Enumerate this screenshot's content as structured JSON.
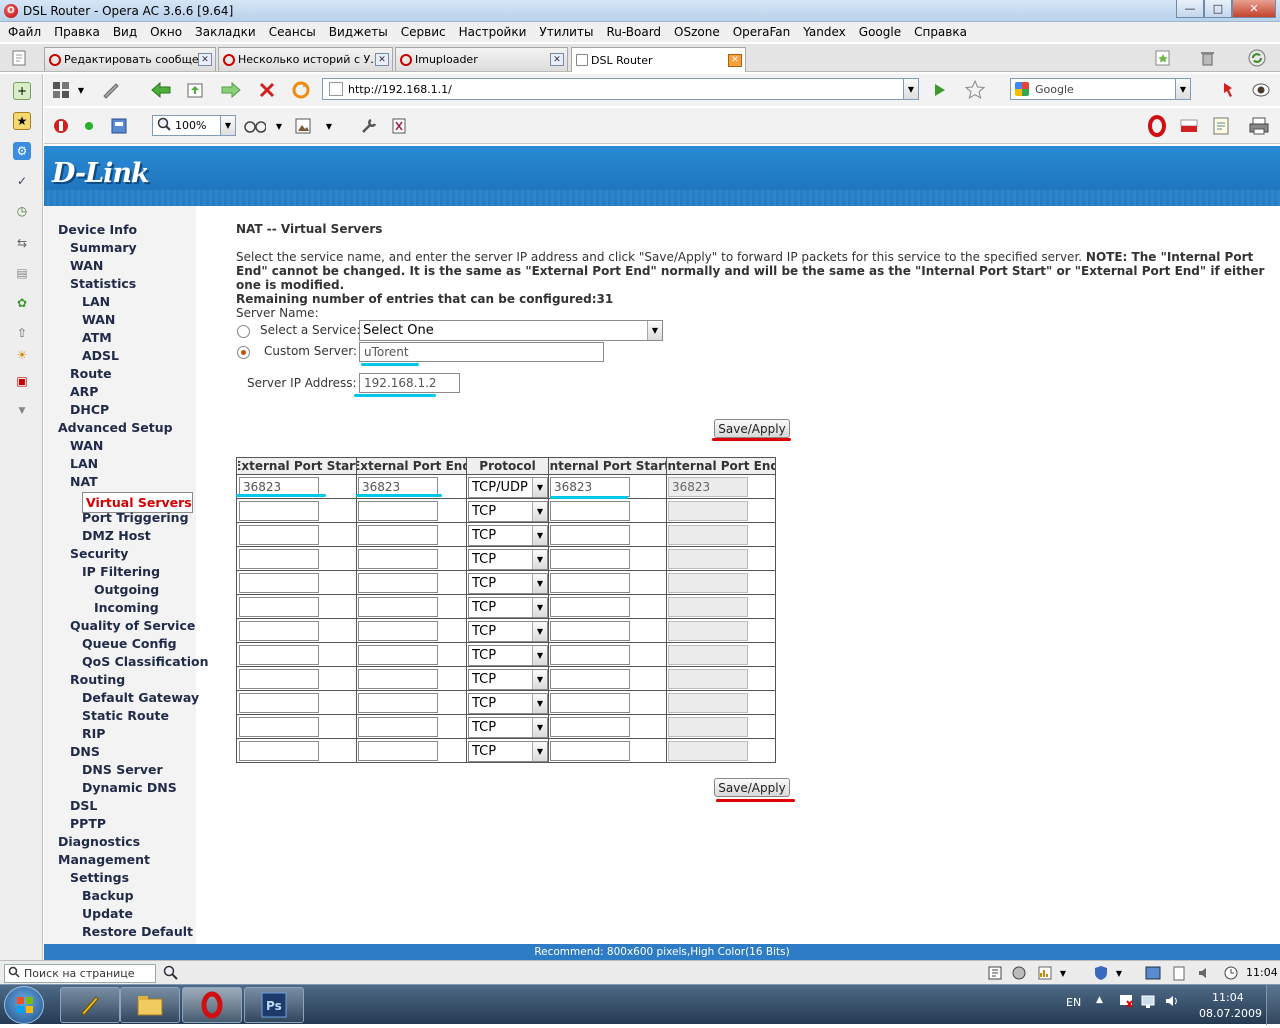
{
  "window": {
    "title": "DSL Router - Opera AC 3.6.6 [9.64]"
  },
  "menu": [
    "Файл",
    "Правка",
    "Вид",
    "Окно",
    "Закладки",
    "Сеансы",
    "Виджеты",
    "Сервис",
    "Настройки",
    "Утилиты",
    "Ru-Board",
    "OSzone",
    "OperaFan",
    "Yandex",
    "Google",
    "Справка"
  ],
  "tabs": [
    {
      "label": "Редактировать сообще..."
    },
    {
      "label": "Несколько историй с У..."
    },
    {
      "label": "Imuploader"
    },
    {
      "label": "DSL Router"
    }
  ],
  "address": {
    "url": "http://192.168.1.1/"
  },
  "search": {
    "engine": "Google"
  },
  "zoom": {
    "level": "100%"
  },
  "brand": {
    "logo": "D-Link"
  },
  "nav": {
    "items": [
      "Device Info",
      "Summary",
      "WAN",
      "Statistics",
      "LAN",
      "WAN",
      "ATM",
      "ADSL",
      "Route",
      "ARP",
      "DHCP",
      "Advanced Setup",
      "WAN",
      "LAN",
      "NAT",
      "Virtual Servers",
      "Port Triggering",
      "DMZ Host",
      "Security",
      "IP Filtering",
      "Outgoing",
      "Incoming",
      "Quality of Service",
      "Queue Config",
      "QoS Classification",
      "Routing",
      "Default Gateway",
      "Static Route",
      "RIP",
      "DNS",
      "DNS Server",
      "Dynamic DNS",
      "DSL",
      "PPTP",
      "Diagnostics",
      "Management",
      "Settings",
      "Backup",
      "Update",
      "Restore Default"
    ]
  },
  "page": {
    "title": "NAT -- Virtual Servers",
    "desc1": "Select the service name, and enter the server IP address and click \"Save/Apply\" to forward IP packets for this service to the specified server.",
    "note": "NOTE: The \"Internal Port End\" cannot be changed. It is the same as \"External Port End\" normally and will be the same as the \"Internal Port Start\" or \"External Port End\" if either one is modified.",
    "remaining": "Remaining number of entries that can be configured:31",
    "server_name_label": "Server Name:",
    "select_service_label": "Select a Service:",
    "select_service_value": "Select One",
    "custom_server_label": "Custom Server:",
    "custom_server_value": "uTorent",
    "server_ip_label": "Server IP Address:",
    "server_ip_value": "192.168.1.2",
    "save_label": "Save/Apply"
  },
  "table": {
    "headers": [
      "External Port Start",
      "External Port End",
      "Protocol",
      "Internal Port Start",
      "Internal Port End"
    ],
    "rows": [
      {
        "ext_start": "36823",
        "ext_end": "36823",
        "protocol": "TCP/UDP",
        "int_start": "36823",
        "int_end": "36823"
      },
      {
        "ext_start": "",
        "ext_end": "",
        "protocol": "TCP",
        "int_start": "",
        "int_end": ""
      },
      {
        "ext_start": "",
        "ext_end": "",
        "protocol": "TCP",
        "int_start": "",
        "int_end": ""
      },
      {
        "ext_start": "",
        "ext_end": "",
        "protocol": "TCP",
        "int_start": "",
        "int_end": ""
      },
      {
        "ext_start": "",
        "ext_end": "",
        "protocol": "TCP",
        "int_start": "",
        "int_end": ""
      },
      {
        "ext_start": "",
        "ext_end": "",
        "protocol": "TCP",
        "int_start": "",
        "int_end": ""
      },
      {
        "ext_start": "",
        "ext_end": "",
        "protocol": "TCP",
        "int_start": "",
        "int_end": ""
      },
      {
        "ext_start": "",
        "ext_end": "",
        "protocol": "TCP",
        "int_start": "",
        "int_end": ""
      },
      {
        "ext_start": "",
        "ext_end": "",
        "protocol": "TCP",
        "int_start": "",
        "int_end": ""
      },
      {
        "ext_start": "",
        "ext_end": "",
        "protocol": "TCP",
        "int_start": "",
        "int_end": ""
      },
      {
        "ext_start": "",
        "ext_end": "",
        "protocol": "TCP",
        "int_start": "",
        "int_end": ""
      },
      {
        "ext_start": "",
        "ext_end": "",
        "protocol": "TCP",
        "int_start": "",
        "int_end": ""
      }
    ]
  },
  "footer": {
    "text": "Recommend: 800x600 pixels,High Color(16 Bits)"
  },
  "status": {
    "find_placeholder": "Поиск на странице",
    "time": "11:04"
  },
  "taskbar": {
    "lang": "EN",
    "time": "11:04",
    "date": "08.07.2009"
  },
  "colors": {
    "banner": "#1a6fb8",
    "nav_selected": "#d20000",
    "annotation_cyan": "#00c8e8",
    "annotation_red": "#e00000"
  }
}
